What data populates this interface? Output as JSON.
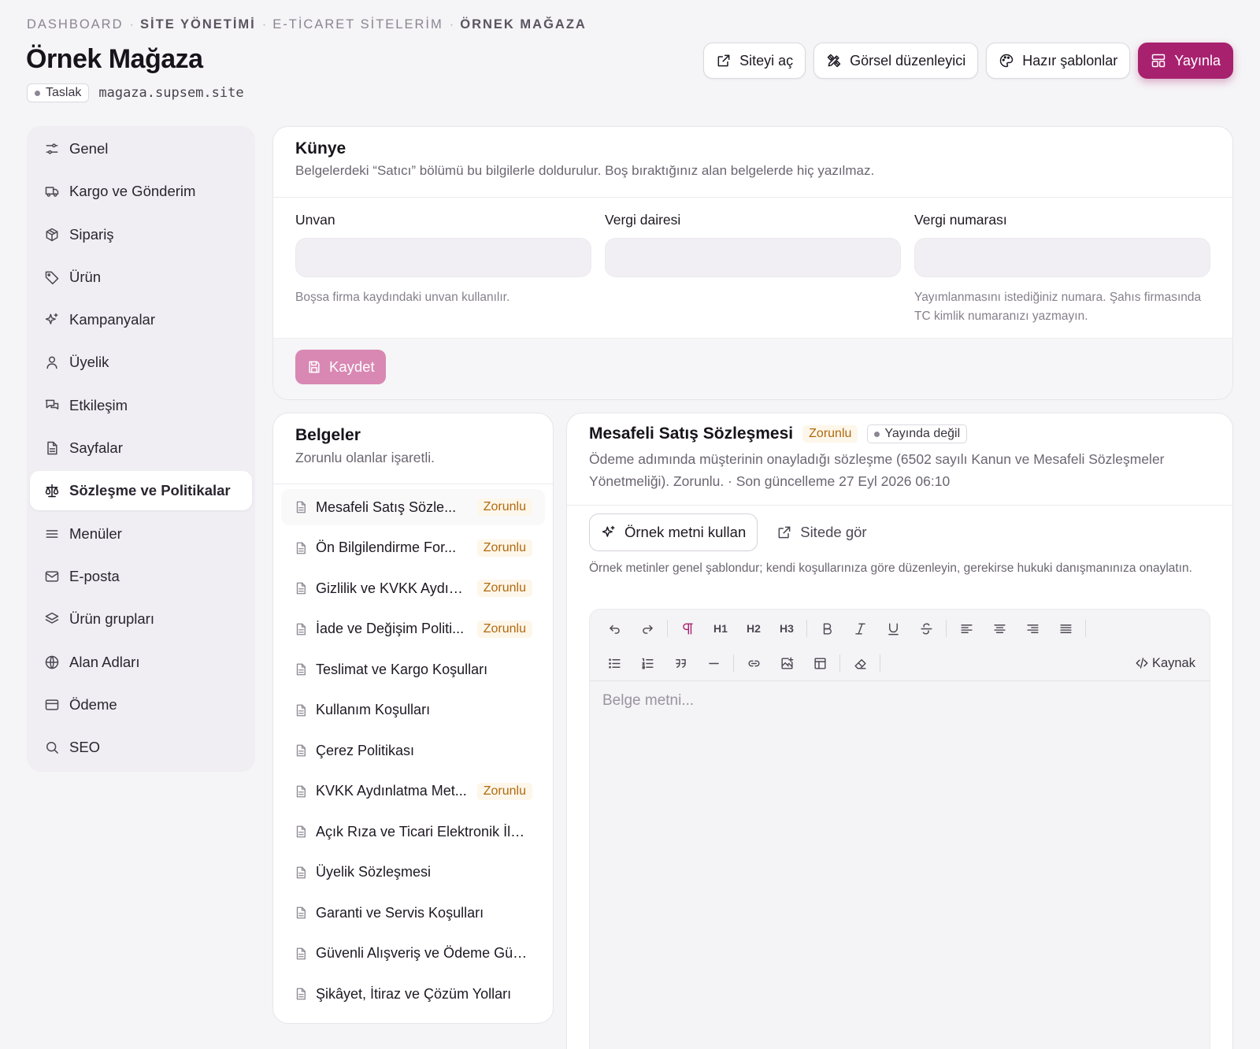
{
  "breadcrumbs": {
    "items": [
      "DASHBOARD",
      "SİTE YÖNETİMİ",
      "E-TİCARET SİTELERİM",
      "ÖRNEK MAĞAZA"
    ],
    "separator": "·"
  },
  "page": {
    "title": "Örnek Mağaza",
    "status": "Taslak",
    "domain": "magaza.supsem.site"
  },
  "header_actions": {
    "open_site": "Siteyi aç",
    "visual_editor": "Görsel düzenleyici",
    "templates": "Hazır şablonlar",
    "publish": "Yayınla"
  },
  "sidebar": {
    "items": [
      {
        "label": "Genel",
        "icon": "sliders-icon"
      },
      {
        "label": "Kargo ve Gönderim",
        "icon": "truck-icon"
      },
      {
        "label": "Sipariş",
        "icon": "package-icon"
      },
      {
        "label": "Ürün",
        "icon": "tag-icon"
      },
      {
        "label": "Kampanyalar",
        "icon": "sparkles-icon"
      },
      {
        "label": "Üyelik",
        "icon": "user-icon"
      },
      {
        "label": "Etkileşim",
        "icon": "messages-icon"
      },
      {
        "label": "Sayfalar",
        "icon": "file-icon"
      },
      {
        "label": "Sözleşme ve Politikalar",
        "icon": "scale-icon",
        "active": true
      },
      {
        "label": "Menüler",
        "icon": "menu-icon"
      },
      {
        "label": "E-posta",
        "icon": "mail-icon"
      },
      {
        "label": "Ürün grupları",
        "icon": "layers-icon"
      },
      {
        "label": "Alan Adları",
        "icon": "globe-icon"
      },
      {
        "label": "Ödeme",
        "icon": "credit-card-icon"
      },
      {
        "label": "SEO",
        "icon": "search-icon"
      }
    ]
  },
  "kunye": {
    "title": "Künye",
    "description": "Belgelerdeki “Satıcı” bölümü bu bilgilerle doldurulur. Boş bıraktığınız alan belgelerde hiç yazılmaz.",
    "fields": [
      {
        "label": "Unvan",
        "value": "",
        "hint": "Boşsa firma kaydındaki unvan kullanılır."
      },
      {
        "label": "Vergi dairesi",
        "value": "",
        "hint": ""
      },
      {
        "label": "Vergi numarası",
        "value": "",
        "hint": "Yayımlanmasını istediğiniz numara. Şahıs firmasında TC kimlik numaranızı yazmayın."
      }
    ],
    "save_label": "Kaydet"
  },
  "documents": {
    "title": "Belgeler",
    "subtitle": "Zorunlu olanlar işaretli.",
    "required_label": "Zorunlu",
    "items": [
      {
        "name": "Mesafeli Satış Sözleşmesi",
        "display": "Mesafeli Satış Sözle...",
        "required": true,
        "active": true
      },
      {
        "name": "Ön Bilgilendirme Formu",
        "display": "Ön Bilgilendirme For...",
        "required": true
      },
      {
        "name": "Gizlilik ve KVKK Aydınlatma",
        "display": "Gizlilik ve KVKK Aydınl...",
        "required": true
      },
      {
        "name": "İade ve Değişim Politikası",
        "display": "İade ve Değişim Politi...",
        "required": true
      },
      {
        "name": "Teslimat ve Kargo Koşulları",
        "display": "Teslimat ve Kargo Koşulları",
        "required": false
      },
      {
        "name": "Kullanım Koşulları",
        "display": "Kullanım Koşulları",
        "required": false
      },
      {
        "name": "Çerez Politikası",
        "display": "Çerez Politikası",
        "required": false
      },
      {
        "name": "KVKK Aydınlatma Metni",
        "display": "KVKK Aydınlatma Met...",
        "required": true
      },
      {
        "name": "Açık Rıza ve Ticari Elektronik İleti",
        "display": "Açık Rıza ve Ticari Elektronik İleti ...",
        "required": false
      },
      {
        "name": "Üyelik Sözleşmesi",
        "display": "Üyelik Sözleşmesi",
        "required": false
      },
      {
        "name": "Garanti ve Servis Koşulları",
        "display": "Garanti ve Servis Koşulları",
        "required": false
      },
      {
        "name": "Güvenli Alışveriş ve Ödeme Güvencesi",
        "display": "Güvenli Alışveriş ve Ödeme Güve...",
        "required": false
      },
      {
        "name": "Şikâyet, İtiraz ve Çözüm Yolları",
        "display": "Şikâyet, İtiraz ve Çözüm Yolları",
        "required": false
      }
    ]
  },
  "editor": {
    "title": "Mesafeli Satış Sözleşmesi",
    "required_badge": "Zorunlu",
    "status_badge": "Yayında değil",
    "description": "Ödeme adımında müşterinin onayladığı sözleşme (6502 sayılı Kanun ve Mesafeli Sözleşmeler Yönetmeliği). Zorunlu. · Son güncelleme 27 Eyl 2026 06:10",
    "use_sample": "Örnek metni kullan",
    "view_on_site": "Sitede gör",
    "note": "Örnek metinler genel şablondur; kendi koşullarınıza göre düzenleyin, gerekirse hukuki danışmanınıza onaylatın.",
    "toolbar": {
      "h1": "H1",
      "h2": "H2",
      "h3": "H3",
      "source": "Kaynak"
    },
    "placeholder": "Belge metni..."
  },
  "colors": {
    "accent": "#a7216f",
    "required_text": "#b06a0e",
    "save_button": "#d888b3"
  }
}
